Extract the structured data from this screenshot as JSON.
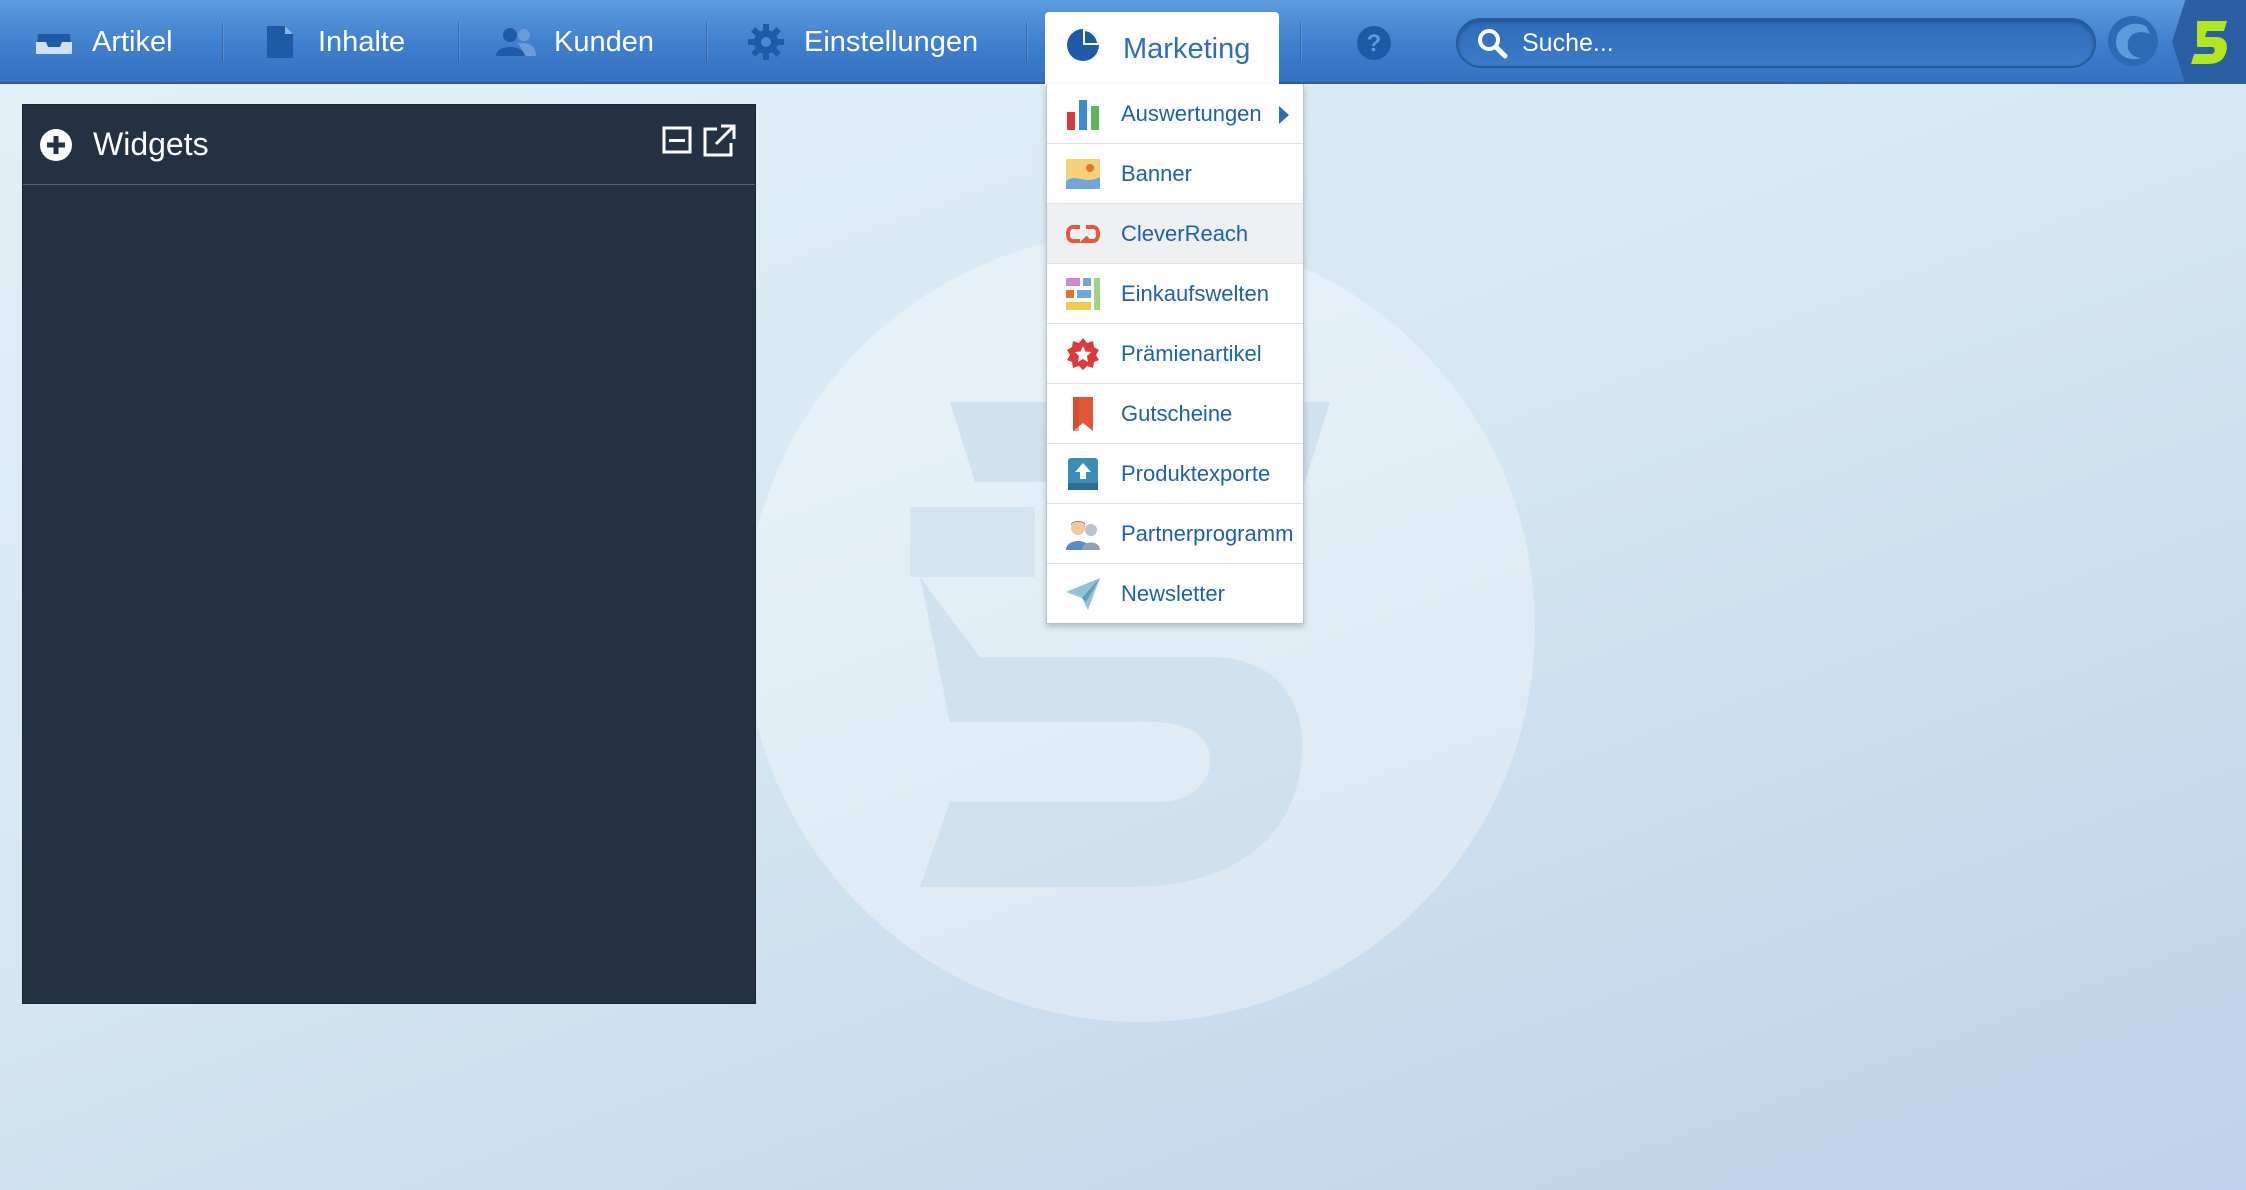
{
  "nav": {
    "items": [
      {
        "label": "Artikel",
        "icon": "inbox-icon"
      },
      {
        "label": "Inhalte",
        "icon": "document-icon"
      },
      {
        "label": "Kunden",
        "icon": "users-icon"
      },
      {
        "label": "Einstellungen",
        "icon": "gear-icon"
      }
    ],
    "active": {
      "label": "Marketing",
      "icon": "pie-chart-icon"
    },
    "help_icon": "question-icon",
    "search_placeholder": "Suche...",
    "logos": [
      "shopware-logo",
      "shopware-5-logo"
    ]
  },
  "widgets": {
    "title": "Widgets",
    "icons": [
      "plus-circle-icon",
      "minimize-icon",
      "external-link-icon"
    ]
  },
  "marketing_menu": {
    "items": [
      {
        "label": "Auswertungen",
        "icon": "bar-chart-icon",
        "has_submenu": true
      },
      {
        "label": "Banner",
        "icon": "image-icon"
      },
      {
        "label": "CleverReach",
        "icon": "cleverreach-icon",
        "hovered": true
      },
      {
        "label": "Einkaufswelten",
        "icon": "layout-grid-icon"
      },
      {
        "label": "Prämienartikel",
        "icon": "award-badge-icon"
      },
      {
        "label": "Gutscheine",
        "icon": "bookmark-icon"
      },
      {
        "label": "Produktexporte",
        "icon": "upload-icon"
      },
      {
        "label": "Partnerprogramm",
        "icon": "partner-icon"
      },
      {
        "label": "Newsletter",
        "icon": "paper-plane-icon"
      }
    ]
  },
  "colors": {
    "topbar": "#3f7fcd",
    "panel": "#243142",
    "link": "#1f5fb0",
    "logo_green": "#b4e61e"
  }
}
